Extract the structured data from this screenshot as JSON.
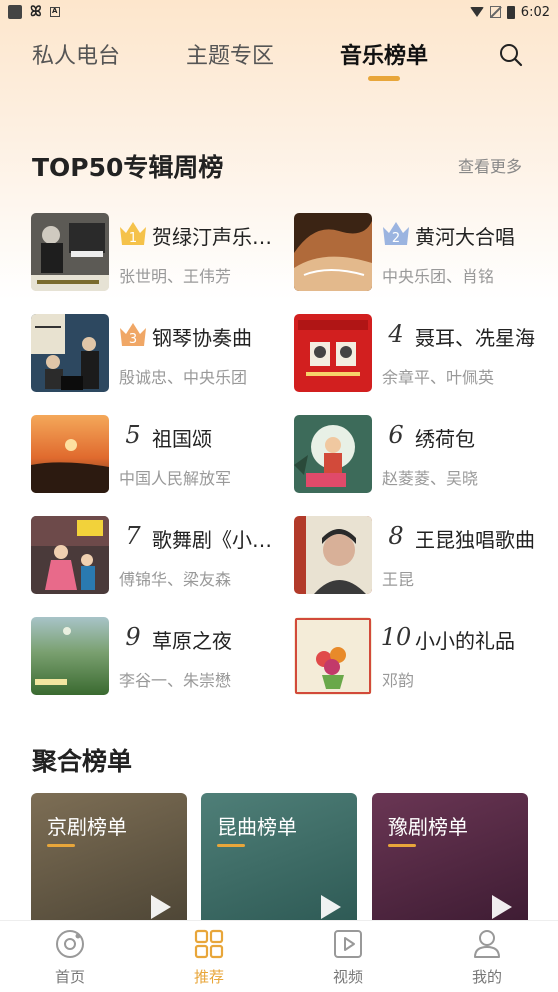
{
  "status_bar": {
    "time": "6:02",
    "icons": [
      "app-notification-icon",
      "bug-icon",
      "text-icon",
      "wifi-icon",
      "no-sim-icon",
      "battery-icon"
    ]
  },
  "top_tabs": [
    {
      "label": "私人电台",
      "active": false
    },
    {
      "label": "主题专区",
      "active": false
    },
    {
      "label": "音乐榜单",
      "active": true
    }
  ],
  "accent_color": "#e8a63a",
  "top50": {
    "title": "TOP50专辑周榜",
    "see_more": "查看更多",
    "albums": [
      {
        "rank": "1",
        "title": "贺绿汀声乐作品",
        "artist": "张世明、王伟芳",
        "crown": "gold"
      },
      {
        "rank": "2",
        "title": "黄河大合唱",
        "artist": "中央乐团、肖铭",
        "crown": "silver"
      },
      {
        "rank": "3",
        "title": "钢琴协奏曲",
        "artist": "殷诚忠、中央乐团",
        "crown": "bronze"
      },
      {
        "rank": "4",
        "title": "聂耳、冼星海",
        "artist": "余章平、叶佩英",
        "crown": ""
      },
      {
        "rank": "5",
        "title": "祖国颂",
        "artist": "中国人民解放军",
        "crown": ""
      },
      {
        "rank": "6",
        "title": "绣荷包",
        "artist": "赵菱菱、吴晓",
        "crown": ""
      },
      {
        "rank": "7",
        "title": "歌舞剧《小二黑结婚》",
        "artist": "傅锦华、梁友森",
        "crown": ""
      },
      {
        "rank": "8",
        "title": "王昆独唱歌曲",
        "artist": "王昆",
        "crown": ""
      },
      {
        "rank": "9",
        "title": "草原之夜",
        "artist": "李谷一、朱崇懋",
        "crown": ""
      },
      {
        "rank": "10",
        "title": "小小的礼品",
        "artist": "邓韵",
        "crown": ""
      }
    ]
  },
  "aggregate": {
    "title": "聚合榜单",
    "cards": [
      {
        "label": "京剧榜单"
      },
      {
        "label": "昆曲榜单"
      },
      {
        "label": "豫剧榜单"
      }
    ]
  },
  "bottom_nav": [
    {
      "label": "首页",
      "icon": "home-icon",
      "active": false
    },
    {
      "label": "推荐",
      "icon": "grid-icon",
      "active": true
    },
    {
      "label": "视频",
      "icon": "video-icon",
      "active": false
    },
    {
      "label": "我的",
      "icon": "profile-icon",
      "active": false
    }
  ]
}
